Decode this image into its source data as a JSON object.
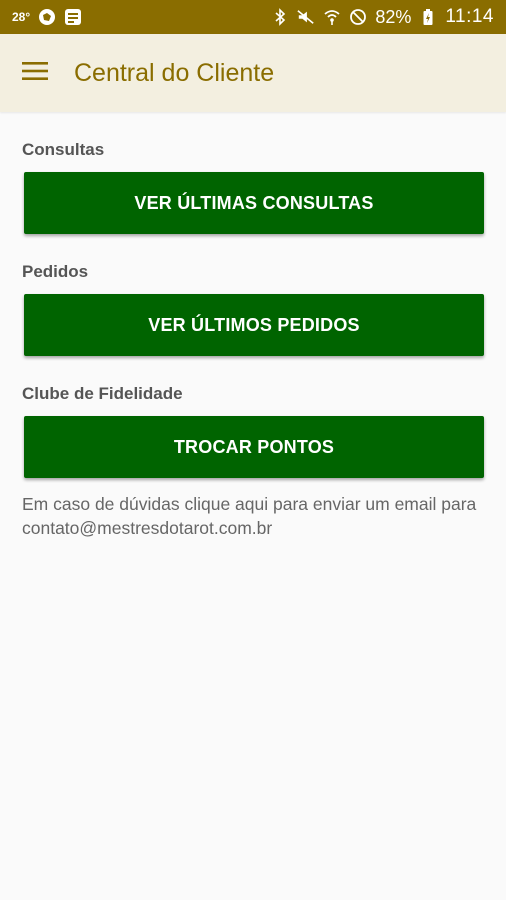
{
  "status_bar": {
    "temperature": "28°",
    "battery_percent": "82%",
    "time": "11:14",
    "icons": [
      "weather-icon",
      "app-icon",
      "bluetooth-icon",
      "mute-icon",
      "wifi-icon",
      "do-not-disturb-icon",
      "battery-charging-icon"
    ]
  },
  "app_bar": {
    "title": "Central do Cliente",
    "menu_icon": "hamburger-menu-icon"
  },
  "sections": [
    {
      "label": "Consultas",
      "button_label": "VER ÚLTIMAS CONSULTAS"
    },
    {
      "label": "Pedidos",
      "button_label": "VER ÚLTIMOS PEDIDOS"
    },
    {
      "label": "Clube de Fidelidade",
      "button_label": "TROCAR PONTOS"
    }
  ],
  "help_text": "Em caso de dúvidas clique aqui para enviar um email para contato@mestresdotarot.com.br",
  "colors": {
    "status_bar": "#8a6d00",
    "app_bar": "#f3efe0",
    "title": "#8a6d00",
    "button": "#006400",
    "background": "#fafafa"
  }
}
